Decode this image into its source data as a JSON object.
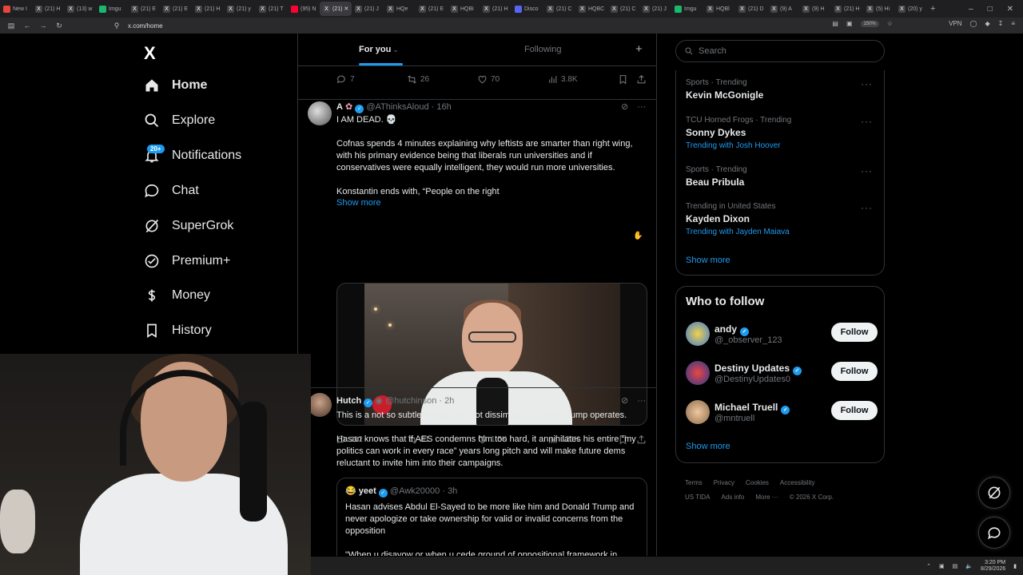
{
  "browser": {
    "tabs": [
      {
        "label": "New I",
        "color": "#e8453c",
        "icon": "browser-icon"
      },
      {
        "label": "(21) H",
        "color": "#444",
        "icon": "x-icon"
      },
      {
        "label": "(13) w",
        "color": "#444",
        "icon": "x-icon"
      },
      {
        "label": "Imgu",
        "color": "#1bb76e",
        "icon": "imgur-icon"
      },
      {
        "label": "(21) E",
        "color": "#444",
        "icon": "x-icon"
      },
      {
        "label": "(21) E",
        "color": "#444",
        "icon": "x-icon"
      },
      {
        "label": "(21) H",
        "color": "#444",
        "icon": "x-icon"
      },
      {
        "label": "(21) y",
        "color": "#444",
        "icon": "x-icon"
      },
      {
        "label": "(21) T",
        "color": "#444",
        "icon": "x-icon"
      },
      {
        "label": "(95) N",
        "color": "#ff0033",
        "icon": "youtube-icon"
      },
      {
        "label": "(21) ✕",
        "color": "#444",
        "icon": "x-icon"
      },
      {
        "label": "(21) J",
        "color": "#444",
        "icon": "x-icon"
      },
      {
        "label": "HQe",
        "color": "#444",
        "icon": "x-icon"
      },
      {
        "label": "(21) E",
        "color": "#444",
        "icon": "x-icon"
      },
      {
        "label": "HQBi",
        "color": "#444",
        "icon": "x-icon"
      },
      {
        "label": "(21) H",
        "color": "#444",
        "icon": "x-icon"
      },
      {
        "label": "Disco",
        "color": "#5865f2",
        "icon": "discord-icon"
      },
      {
        "label": "(21) C",
        "color": "#444",
        "icon": "x-icon"
      },
      {
        "label": "HQBC",
        "color": "#444",
        "icon": "x-icon"
      },
      {
        "label": "(21) C",
        "color": "#444",
        "icon": "x-icon"
      },
      {
        "label": "(21) J",
        "color": "#444",
        "icon": "x-icon"
      },
      {
        "label": "Imgu",
        "color": "#1bb76e",
        "icon": "imgur-icon"
      },
      {
        "label": "HQBl",
        "color": "#444",
        "icon": "x-icon"
      },
      {
        "label": "(21) D",
        "color": "#444",
        "icon": "x-icon"
      },
      {
        "label": "(9) A",
        "color": "#444",
        "icon": "x-icon"
      },
      {
        "label": "(9) H",
        "color": "#444",
        "icon": "x-icon"
      },
      {
        "label": "(21) H",
        "color": "#444",
        "icon": "x-icon"
      },
      {
        "label": "(5) Hi",
        "color": "#444",
        "icon": "x-icon"
      },
      {
        "label": "(20) y",
        "color": "#444",
        "icon": "x-icon"
      }
    ],
    "active_tab_index": 10,
    "url": "x.com/home",
    "zoom": "150%",
    "vpn_label": "VPN"
  },
  "nav": {
    "logo": "X",
    "items": [
      {
        "label": "Home",
        "icon": "home-icon",
        "active": true
      },
      {
        "label": "Explore",
        "icon": "search-icon"
      },
      {
        "label": "Notifications",
        "icon": "bell-icon",
        "badge": "20+"
      },
      {
        "label": "Chat",
        "icon": "chat-icon"
      },
      {
        "label": "SuperGrok",
        "icon": "grok-icon"
      },
      {
        "label": "Premium+",
        "icon": "premium-icon"
      },
      {
        "label": "Money",
        "icon": "money-icon"
      },
      {
        "label": "History",
        "icon": "bookmark-icon"
      }
    ]
  },
  "feed": {
    "tab_for_you": "For you",
    "tab_following": "Following",
    "top_actions": {
      "replies": "7",
      "reposts": "26",
      "likes": "70",
      "views": "3.8K"
    },
    "post1": {
      "name": "A",
      "handle": "@AThinksAloud",
      "time": "16h",
      "headline": "I AM DEAD. 💀",
      "body": "Cofnas spends 4 minutes explaining why leftists are smarter than right wing, with his primary evidence being that liberals run universities and if conservatives were equally intelligent, they would run more universities.",
      "body2": "Konstantin ends with, “People on the right",
      "show_more": "Show more",
      "actions": {
        "replies": "112",
        "reposts": "81",
        "likes": "1.5K",
        "views": "121K"
      }
    },
    "post2": {
      "name": "Hutch",
      "handle": "@hutchinson",
      "time": "2h",
      "body1": "This is a not so subtle loyalty test, not dissimilar from how Trump operates.",
      "body2": "Hasan knows that if AES condemns him too hard, it annihilates his entire “my politics can work in every race” years long pitch and will make future dems reluctant to invite him into their campaigns.",
      "quote": {
        "name": "yeet",
        "handle": "@Awk20000",
        "time": "3h",
        "body": "Hasan advises Abdul El-Sayed to be more like him and Donald Trump and never apologize or take ownership for valid or invalid concerns from the opposition",
        "body2": "\"When u disavow or when u cede ground of oppositional framework in"
      }
    }
  },
  "right": {
    "search_placeholder": "Search",
    "trends": [
      {
        "context": "Sports · Trending",
        "title": "Kevin McGonigle",
        "with": ""
      },
      {
        "context": "TCU Horned Frogs · Trending",
        "title": "Sonny Dykes",
        "with_prefix": "Trending with",
        "with": "Josh Hoover"
      },
      {
        "context": "Sports · Trending",
        "title": "Beau Pribula",
        "with": ""
      },
      {
        "context": "Trending in United States",
        "title": "Kayden Dixon",
        "with_prefix": "Trending with",
        "with": "Jayden Maiava"
      }
    ],
    "trends_show_more": "Show more",
    "who_to_follow": "Who to follow",
    "follow_users": [
      {
        "name": "andy",
        "handle": "@_observer_123",
        "button": "Follow"
      },
      {
        "name": "Destiny Updates",
        "handle": "@DestinyUpdates0",
        "button": "Follow"
      },
      {
        "name": "Michael Truell",
        "handle": "@mntruell",
        "button": "Follow"
      }
    ],
    "follow_show_more": "Show more",
    "footer": [
      "Terms",
      "Privacy",
      "Cookies",
      "Accessibility",
      "US TIDA",
      "Ads info",
      "More ···",
      "© 2026 X Corp."
    ]
  },
  "taskbar": {
    "time": "3:20 PM",
    "date": "8/29/2026"
  },
  "colors": {
    "accent": "#1d9bf0",
    "border": "#2f3336",
    "muted": "#71767b"
  }
}
